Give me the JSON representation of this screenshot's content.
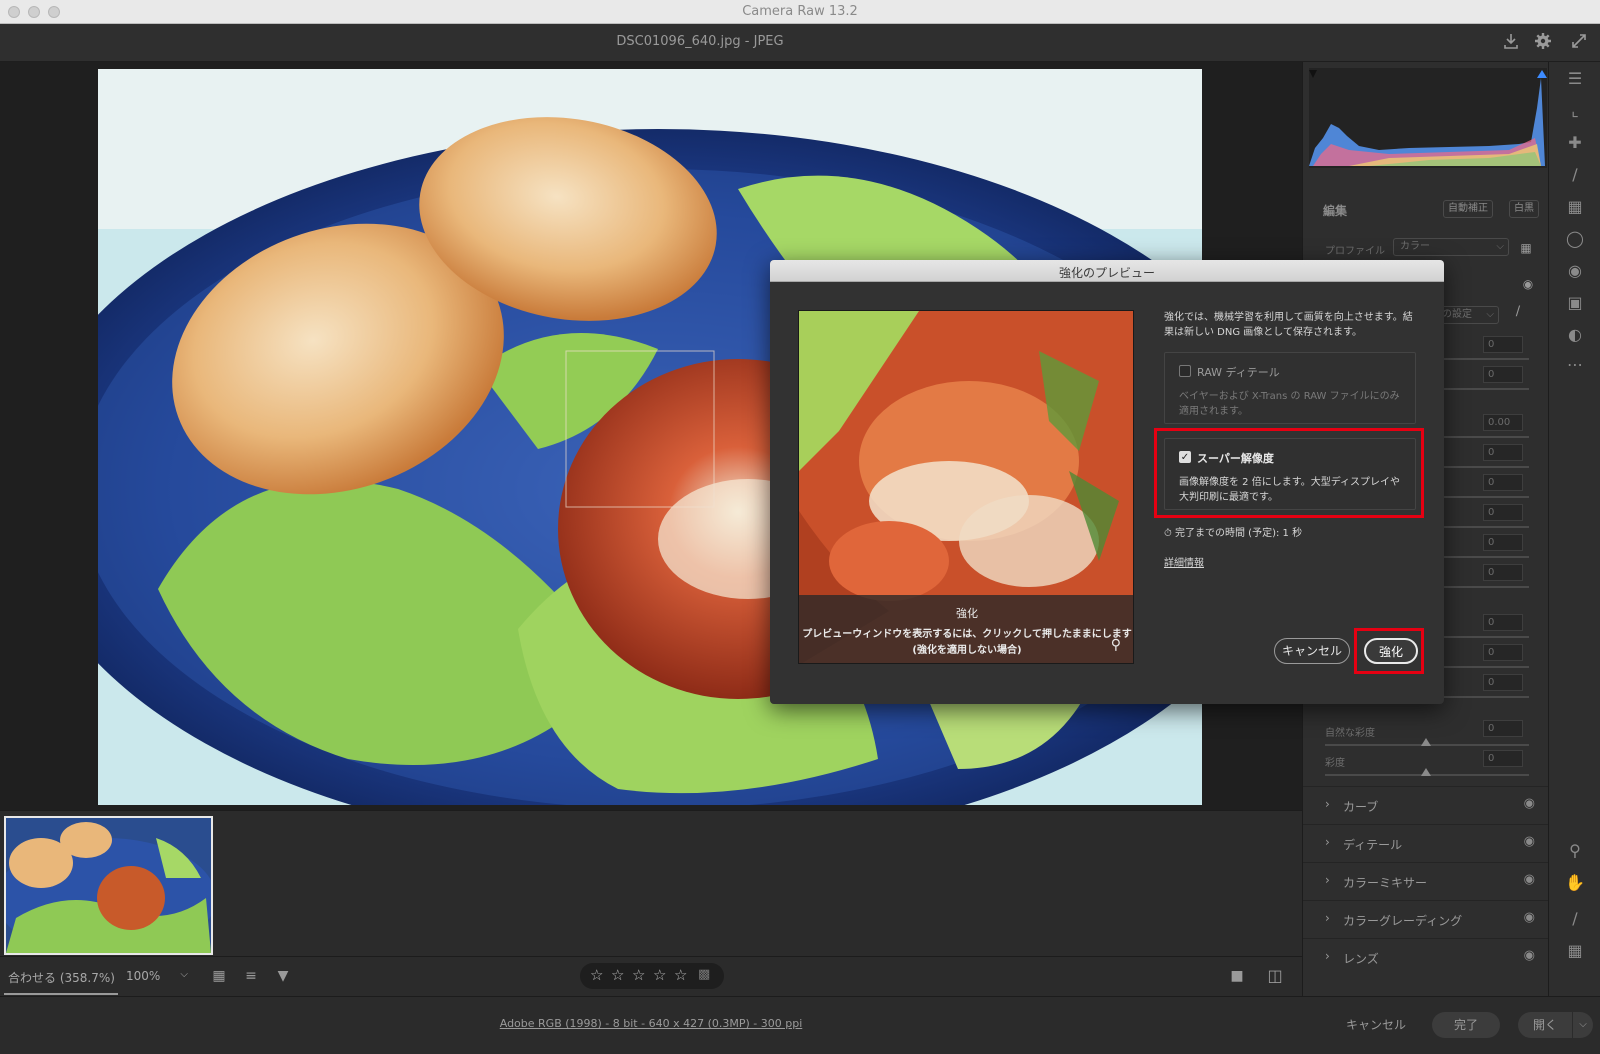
{
  "app": {
    "window_title": "Camera Raw 13.2",
    "document_title": "DSC01096_640.jpg  -  JPEG"
  },
  "icons": {
    "save": "download-icon",
    "settings": "gear-icon",
    "fullscreen": "expand-icon"
  },
  "bottom_bar": {
    "fit_label": "合わせる (358.7%)",
    "zoom_value": "100%",
    "rating_stars": 0
  },
  "status_bar": {
    "image_info": "Adobe RGB (1998) - 8 bit - 640 x 427 (0.3MP) - 300 ppi",
    "cancel_label": "キャンセル",
    "done_label": "完了",
    "open_label": "開く"
  },
  "right_panel": {
    "edit_heading": "編集",
    "auto_label": "自動補正",
    "bw_label": "白黒",
    "profile_label": "プロファイル",
    "profile_value": "カラー",
    "wb_value": "の設定",
    "values": [
      "0",
      "0",
      "0.00",
      "0",
      "0",
      "0",
      "0",
      "0",
      "0",
      "0",
      "0"
    ],
    "vibrance_label": "自然な彩度",
    "vibrance_value": "0",
    "saturation_label": "彩度",
    "saturation_value": "0",
    "sections": [
      {
        "name": "カーブ"
      },
      {
        "name": "ディテール"
      },
      {
        "name": "カラーミキサー"
      },
      {
        "name": "カラーグレーディング"
      },
      {
        "name": "レンズ"
      }
    ]
  },
  "dialog": {
    "title": "強化のプレビュー",
    "preview_caption_title": "強化",
    "preview_caption_line1": "プレビューウィンドウを表示するには、クリックして押したままにします",
    "preview_caption_line2": "(強化を適用しない場合)",
    "intro_text": "強化では、機械学習を利用して画質を向上させます。結果は新しい DNG 画像として保存されます。",
    "raw_detail": {
      "label": "RAW ディテール",
      "checked": false,
      "description": "ベイヤーおよび X-Trans の RAW ファイルにのみ適用されます。"
    },
    "super_resolution": {
      "label": "スーパー解像度",
      "checked": true,
      "description": "画像解像度を 2 倍にします。大型ディスプレイや大判印刷に最適です。"
    },
    "time_estimate": "完了までの時間 (予定): 1 秒",
    "details_link": "詳細情報",
    "cancel_label": "キャンセル",
    "enhance_label": "強化",
    "highlight_color": "#e60012"
  }
}
